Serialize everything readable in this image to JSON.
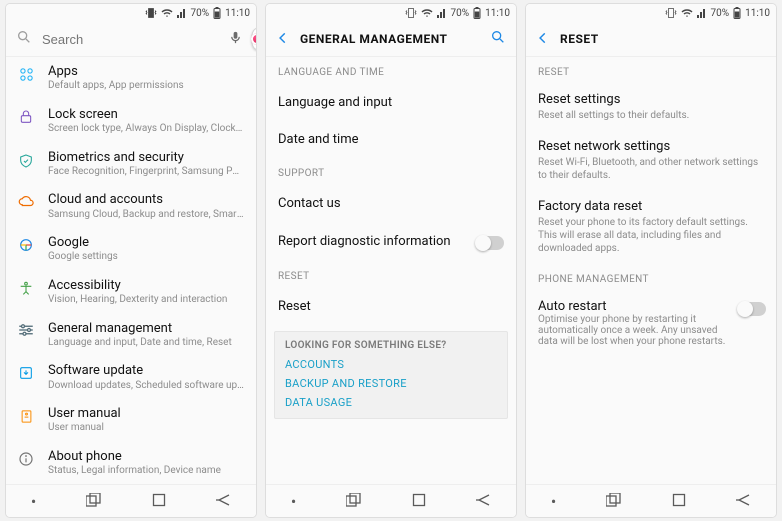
{
  "status": {
    "battery": "70%",
    "time": "11:10"
  },
  "screen1": {
    "search_placeholder": "Search",
    "items": [
      {
        "key": "apps",
        "title": "Apps",
        "sub": "Default apps, App permissions"
      },
      {
        "key": "lockscreen",
        "title": "Lock screen",
        "sub": "Screen lock type, Always On Display, Clock style"
      },
      {
        "key": "biometrics",
        "title": "Biometrics and security",
        "sub": "Face Recognition, Fingerprint, Samsung Pass,..."
      },
      {
        "key": "cloud",
        "title": "Cloud and accounts",
        "sub": "Samsung Cloud, Backup and restore, Smart Sw..."
      },
      {
        "key": "google",
        "title": "Google",
        "sub": "Google settings"
      },
      {
        "key": "a11y",
        "title": "Accessibility",
        "sub": "Vision, Hearing, Dexterity and interaction"
      },
      {
        "key": "general",
        "title": "General management",
        "sub": "Language and input, Date and time, Reset"
      },
      {
        "key": "swupdate",
        "title": "Software update",
        "sub": "Download updates, Scheduled software update..."
      },
      {
        "key": "manual",
        "title": "User manual",
        "sub": "User manual"
      },
      {
        "key": "about",
        "title": "About phone",
        "sub": "Status, Legal information, Device name"
      }
    ]
  },
  "screen2": {
    "header_title": "GENERAL MANAGEMENT",
    "section_langtime": "LANGUAGE AND TIME",
    "row_language": "Language and input",
    "row_datetime": "Date and time",
    "section_support": "SUPPORT",
    "row_contact": "Contact us",
    "row_diag": "Report diagnostic information",
    "section_reset": "RESET",
    "row_reset": "Reset",
    "suggest_hdr": "LOOKING FOR SOMETHING ELSE?",
    "suggest_links": [
      "ACCOUNTS",
      "BACKUP AND RESTORE",
      "DATA USAGE"
    ]
  },
  "screen3": {
    "header_title": "RESET",
    "section_reset": "RESET",
    "reset_settings_t": "Reset settings",
    "reset_settings_d": "Reset all settings to their defaults.",
    "reset_net_t": "Reset network settings",
    "reset_net_d": "Reset Wi-Fi, Bluetooth, and other network settings to their defaults.",
    "factory_t": "Factory data reset",
    "factory_d": "Reset your phone to its factory default settings. This will erase all data, including files and downloaded apps.",
    "section_phonemgmt": "PHONE MANAGEMENT",
    "autorestart_t": "Auto restart",
    "autorestart_d": "Optimise your phone by restarting it automatically once a week. Any unsaved data will be lost when your phone restarts."
  }
}
